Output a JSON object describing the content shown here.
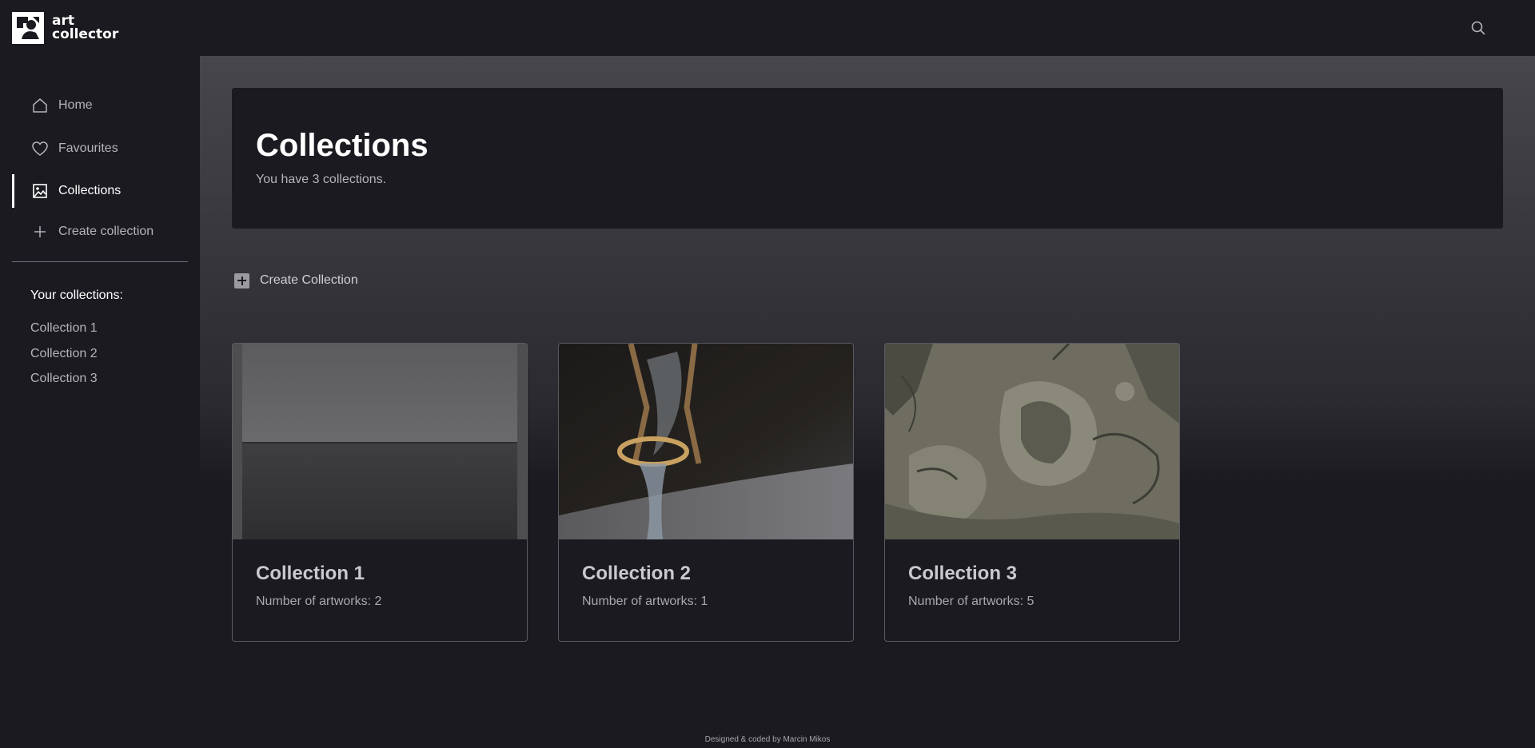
{
  "brand": {
    "line1": "art",
    "line2": "collector"
  },
  "sidebar": {
    "nav": [
      {
        "label": "Home",
        "icon": "home-icon"
      },
      {
        "label": "Favourites",
        "icon": "heart-icon"
      },
      {
        "label": "Collections",
        "icon": "image-icon",
        "active": true
      },
      {
        "label": "Create collection",
        "icon": "plus-icon"
      }
    ],
    "your_collections_heading": "Your collections:",
    "collections": [
      "Collection 1",
      "Collection 2",
      "Collection 3"
    ]
  },
  "main": {
    "title": "Collections",
    "subtitle": "You have 3 collections.",
    "create_button_label": "Create Collection",
    "cards": [
      {
        "title": "Collection 1",
        "count": "Number of artworks: 2",
        "image": "seascape-photo"
      },
      {
        "title": "Collection 2",
        "count": "Number of artworks: 1",
        "image": "hourglass-photo"
      },
      {
        "title": "Collection 3",
        "count": "Number of artworks: 5",
        "image": "engraving-print"
      }
    ]
  },
  "footer": {
    "credit": "Designed & coded by Marcin Mikos"
  },
  "colors": {
    "background": "#1b1a20",
    "text_primary": "#ffffff",
    "text_secondary": "#b3b3ba",
    "border": "#5a5a62"
  }
}
